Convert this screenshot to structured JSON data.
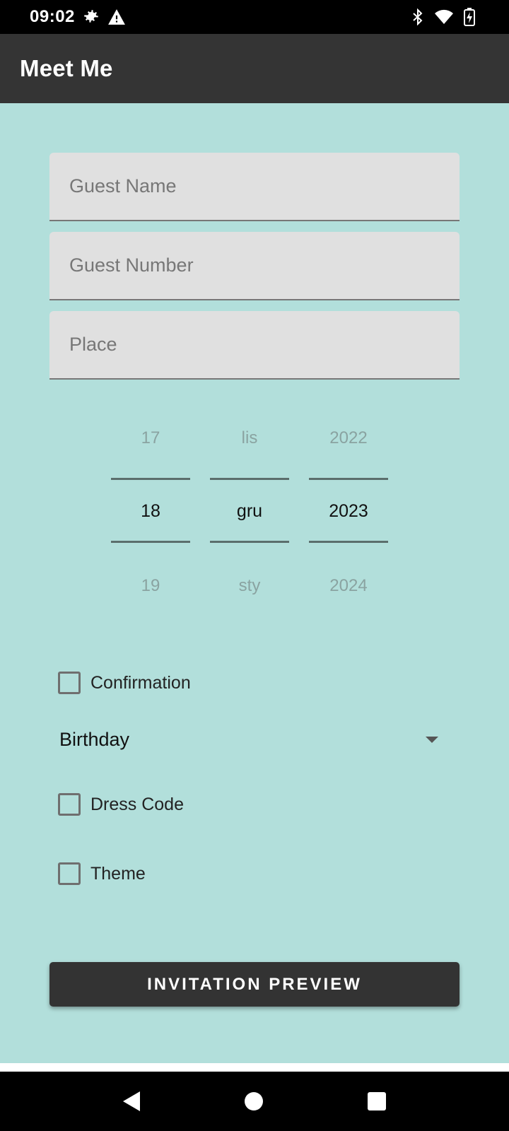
{
  "status_bar": {
    "time": "09:02",
    "icons_left": [
      "settings-gear-icon",
      "warning-icon"
    ],
    "icons_right": [
      "bluetooth-icon",
      "wifi-icon",
      "battery-icon"
    ]
  },
  "app_bar": {
    "title": "Meet Me",
    "color": "#343434"
  },
  "background_color": "#b2dfdb",
  "form": {
    "guest_name_placeholder": "Guest Name",
    "guest_number_placeholder": "Guest Number",
    "place_placeholder": "Place",
    "date_picker": {
      "day": {
        "prev": "17",
        "selected": "18",
        "next": "19"
      },
      "month": {
        "prev": "lis",
        "selected": "gru",
        "next": "sty"
      },
      "year": {
        "prev": "2022",
        "selected": "2023",
        "next": "2024"
      }
    },
    "confirmation_label": "Confirmation",
    "event_type_selected": "Birthday",
    "dress_code_label": "Dress Code",
    "theme_label": "Theme",
    "preview_button_label": "INVITATION PREVIEW"
  },
  "nav_bar": {
    "icons": [
      "back-icon",
      "home-icon",
      "recents-icon"
    ]
  }
}
